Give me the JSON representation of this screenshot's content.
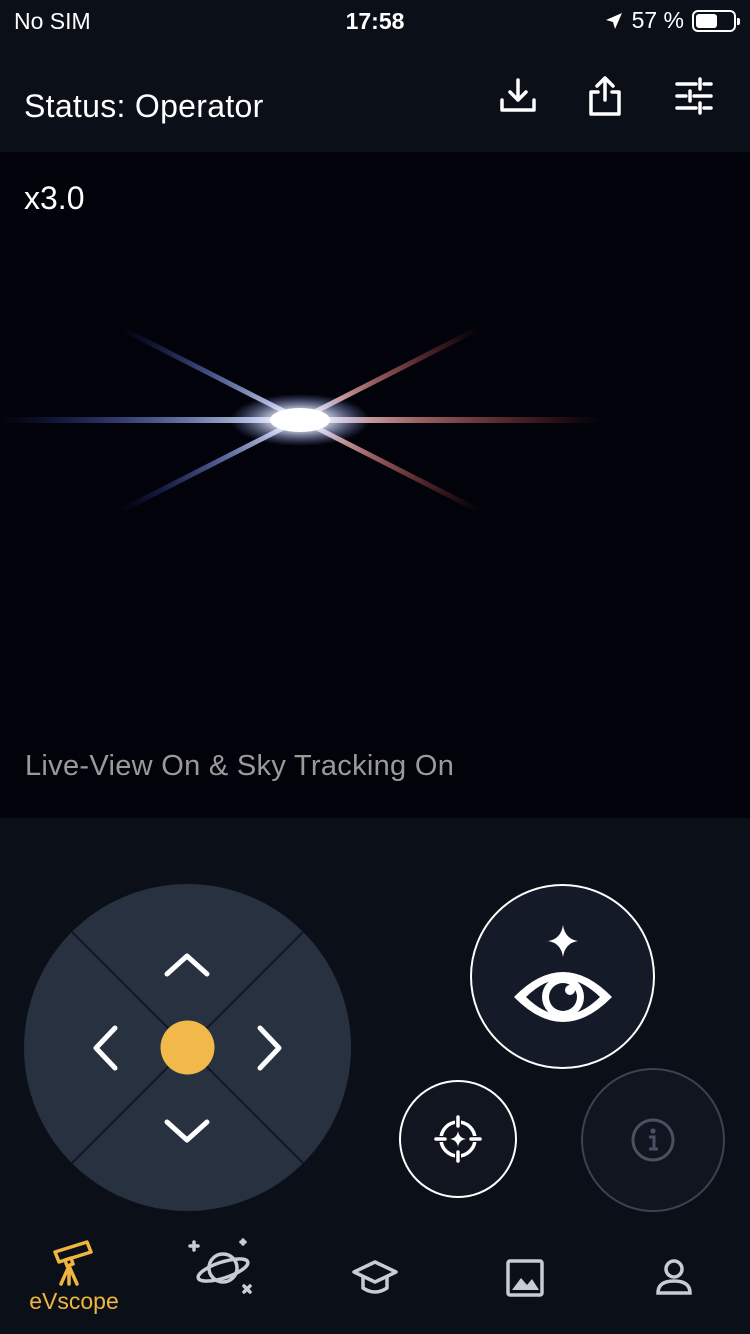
{
  "status_bar": {
    "carrier": "No SIM",
    "time": "17:58",
    "battery_percent": "57 %",
    "battery_level": 0.57
  },
  "header": {
    "title": "Status: Operator",
    "icons": [
      "download-icon",
      "share-icon",
      "sliders-icon"
    ]
  },
  "viewer": {
    "zoom": "x3.0",
    "status": "Live-View On & Sky Tracking On"
  },
  "controls": {
    "joystick": {
      "icons": [
        "chevron-up-icon",
        "chevron-left-icon",
        "chevron-right-icon",
        "chevron-down-icon"
      ],
      "center_color": "#f0b94a"
    },
    "observe_icon": "eye-sparkle-icon",
    "target_icon": "crosshair-icon",
    "info_icon": "info-icon"
  },
  "tabbar": {
    "active_color": "#f0b53e",
    "tabs": [
      {
        "icon": "telescope-icon",
        "label": "eVscope",
        "active": true
      },
      {
        "icon": "planet-icon",
        "label": "",
        "active": false
      },
      {
        "icon": "graduation-cap-icon",
        "label": "",
        "active": false
      },
      {
        "icon": "image-icon",
        "label": "",
        "active": false
      },
      {
        "icon": "user-icon",
        "label": "",
        "active": false
      }
    ]
  }
}
